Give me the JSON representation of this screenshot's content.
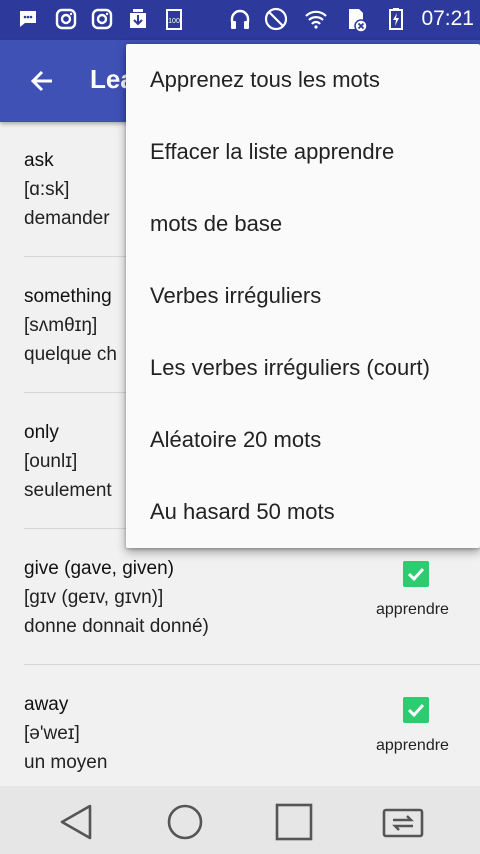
{
  "status_bar": {
    "time": "07:21",
    "icons": [
      "messages-icon",
      "instagram-icon",
      "instagram-icon",
      "download-icon",
      "battery-100-icon",
      "headphones-icon",
      "no-vibrate-icon",
      "wifi-icon",
      "sim-error-icon",
      "battery-charging-icon"
    ]
  },
  "appbar": {
    "title": "Lea",
    "back_icon": "back-arrow-icon"
  },
  "list": {
    "checkbox_label": "apprendre",
    "items": [
      {
        "word": "ask",
        "phonetic": "[ɑ:sk]",
        "translation": "demander"
      },
      {
        "word": "something",
        "phonetic": "[sʌmθɪŋ]",
        "translation": "quelque ch"
      },
      {
        "word": "only",
        "phonetic": "[ounlɪ]",
        "translation": "seulement"
      },
      {
        "word": "give (gave, given)",
        "phonetic": "[gɪv (geɪv, gɪvn)]",
        "translation": "donne donnait donné)"
      },
      {
        "word": "away",
        "phonetic": "[ə'weɪ]",
        "translation": "un moyen"
      }
    ]
  },
  "menu": {
    "items": [
      "Apprenez tous les mots",
      "Effacer la liste apprendre",
      "mots de base",
      "Verbes irréguliers",
      "Les verbes irréguliers (court)",
      "Aléatoire 20 mots",
      "Au hasard 50 mots"
    ]
  },
  "colors": {
    "status_bar": "#2d3a9c",
    "app_bar": "#3f51b5",
    "checkbox": "#2ecc71"
  }
}
